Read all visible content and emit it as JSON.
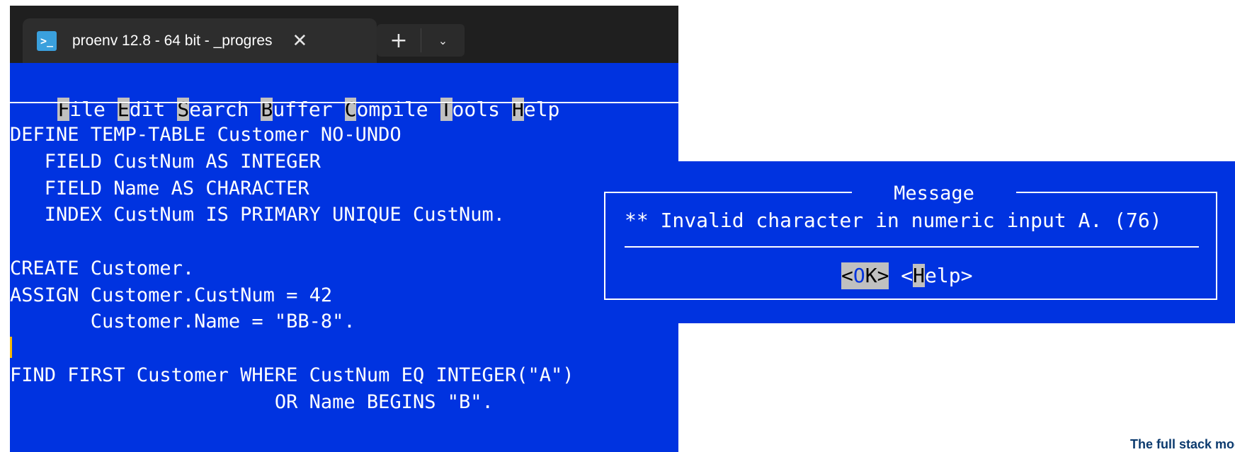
{
  "window": {
    "tab_icon": "terminal-icon",
    "tab_icon_glyph": ">_",
    "tab_title": "proenv 12.8 - 64 bit - _progres",
    "close_glyph": "✕",
    "new_tab_glyph": "+",
    "dropdown_glyph": "⌄"
  },
  "menu": {
    "items": [
      {
        "hotkey": "F",
        "rest": "ile"
      },
      {
        "hotkey": "E",
        "rest": "dit"
      },
      {
        "hotkey": "S",
        "rest": "earch"
      },
      {
        "hotkey": "B",
        "rest": "uffer"
      },
      {
        "hotkey": "C",
        "rest": "ompile"
      },
      {
        "hotkey": "T",
        "rest": "ools"
      },
      {
        "hotkey": "H",
        "rest": "elp"
      }
    ]
  },
  "editor": {
    "lines": [
      "DEFINE TEMP-TABLE Customer NO-UNDO",
      "   FIELD CustNum AS INTEGER",
      "   FIELD Name AS CHARACTER",
      "   INDEX CustNum IS PRIMARY UNIQUE CustNum.",
      "",
      "CREATE Customer.",
      "ASSIGN Customer.CustNum = 42",
      "       Customer.Name = \"BB-8\".",
      "",
      "FIND FIRST Customer WHERE CustNum EQ INTEGER(\"A\")",
      "                       OR Name BEGINS \"B\"."
    ]
  },
  "dialog": {
    "title": " Message ",
    "message": "** Invalid character in numeric input A. (76)",
    "ok": {
      "open": "<",
      "hotkey": "O",
      "rest": "K>"
    },
    "help": {
      "open": "<",
      "hotkey": "H",
      "rest": "elp>"
    }
  },
  "footer": {
    "tagline": "The full stack moderniz"
  },
  "colors": {
    "terminal_bg": "#0033e0",
    "text": "#ffffff",
    "hotkey_bg": "#c0c0c0",
    "cursor": "#f5b800",
    "titlebar": "#1f1f1f",
    "tagline": "#0b3a6e"
  }
}
